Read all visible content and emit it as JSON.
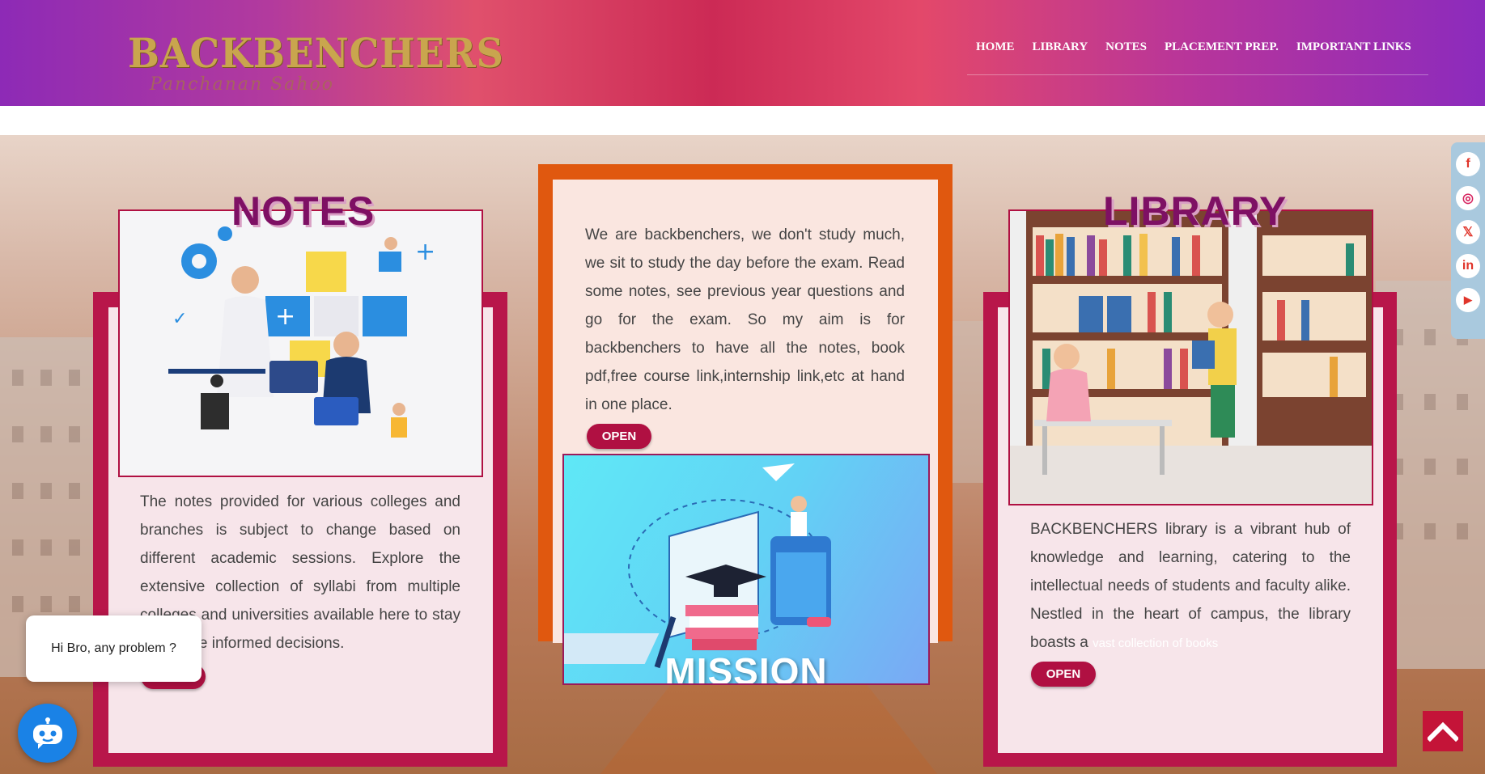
{
  "header": {
    "logo_main": "BACKBENCHERS",
    "logo_sub": "Panchanan Sahoo",
    "nav": [
      "HOME",
      "LIBRARY",
      "NOTES",
      "PLACEMENT PREP.",
      "IMPORTANT LINKS"
    ]
  },
  "notes": {
    "title": "NOTES",
    "text": "The notes provided for various colleges and branches is subject to change based on different academic sessions. Explore the extensive collection of syllabi from multiple colleges and universities available here to stay and make informed decisions.",
    "button": "OPEN"
  },
  "center": {
    "text": "We are backbenchers, we don't study much, we sit to study the day before the exam. Read some notes, see previous year questions and go for the exam. So my aim is for backbenchers to have all the notes, book pdf,free course link,internship link,etc at hand in one place.",
    "button": "OPEN",
    "mission_title": "MISSION"
  },
  "library": {
    "title": "LIBRARY",
    "text_before_link": "BACKBENCHERS library is a vibrant hub of knowledge and learning, catering to the intellectual needs of students and faculty alike. Nestled in the heart of campus, the library boasts a",
    "link_text": "vast collection of books",
    "button": "OPEN"
  },
  "social": [
    "facebook-icon",
    "instagram-icon",
    "x-icon",
    "linkedin-icon",
    "youtube-icon"
  ],
  "social_glyphs": [
    "f",
    "◎",
    "𝕏",
    "in",
    "▶"
  ],
  "chat": {
    "bubble": "Hi Bro, any problem ?"
  },
  "colors": {
    "accent": "#b8164a",
    "center_frame": "#e0580f",
    "title": "#7e1064",
    "chat": "#1a82e6"
  }
}
